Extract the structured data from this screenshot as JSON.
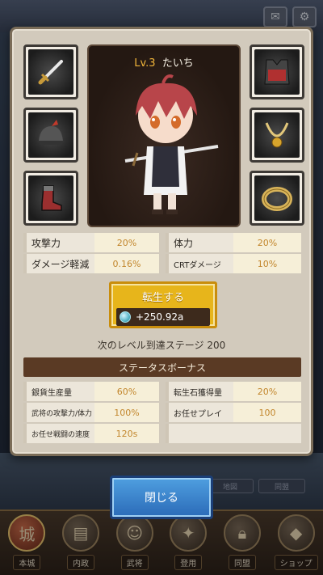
{
  "character": {
    "level": "Lv.3",
    "name": "たいち"
  },
  "stats": [
    {
      "label": "攻撃力",
      "value": "20%"
    },
    {
      "label": "体力",
      "value": "20%"
    },
    {
      "label": "ダメージ軽減",
      "value": "0.16%"
    },
    {
      "label": "CRTダメージ",
      "value": "10%"
    }
  ],
  "rebirth": {
    "label": "転生する",
    "value": "+250.92a"
  },
  "next_stage": "次のレベル到達ステージ 200",
  "bonus_header": "ステータスボーナス",
  "bonuses": [
    {
      "label": "銀貨生産量",
      "value": "60%"
    },
    {
      "label": "転生石獲得量",
      "value": "20%"
    },
    {
      "label": "武将の攻撃力/体力",
      "value": "100%"
    },
    {
      "label": "お任せプレイ",
      "value": "100"
    },
    {
      "label": "お任せ戦闘の速度",
      "value": "120s"
    }
  ],
  "close_label": "閉じる",
  "bottom_nav": [
    {
      "label": "本城"
    },
    {
      "label": "内政"
    },
    {
      "label": "武将"
    },
    {
      "label": "登用"
    },
    {
      "label": "同盟"
    },
    {
      "label": "ショップ"
    }
  ],
  "background_tabs": [
    "地図",
    "同盟"
  ],
  "colors": {
    "accent_gold": "#e7b51b",
    "value_orange": "#c2862c",
    "header_brown": "#5a3a24",
    "close_blue": "#2b6bb8"
  }
}
